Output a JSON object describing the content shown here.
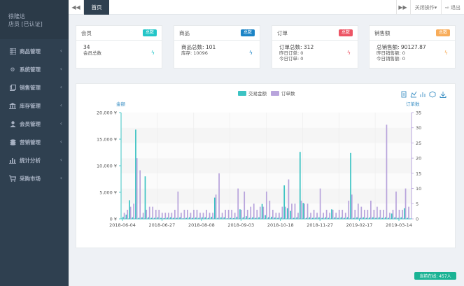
{
  "user": {
    "name": "徐隆达",
    "role": "店员 [已认证]"
  },
  "sidebar": {
    "items": [
      {
        "label": "商品管理",
        "icon": "grid-icon"
      },
      {
        "label": "系统管理",
        "icon": "gear-icon"
      },
      {
        "label": "销售管理",
        "icon": "copy-icon"
      },
      {
        "label": "库存管理",
        "icon": "bank-icon"
      },
      {
        "label": "会员管理",
        "icon": "user-icon"
      },
      {
        "label": "营销管理",
        "icon": "coins-icon"
      },
      {
        "label": "统计分析",
        "icon": "bar-chart-icon"
      },
      {
        "label": "采购市场",
        "icon": "cart-icon"
      }
    ]
  },
  "topbar": {
    "tab": "首页",
    "close_ops": "关闭操作",
    "exit": "退出"
  },
  "cards": [
    {
      "title": "会员",
      "badge": "总数",
      "badge_color": "#23c6c8",
      "bolt_color": "#23c6c8",
      "lines": [
        "34",
        "会员总数"
      ]
    },
    {
      "title": "商品",
      "badge": "总数",
      "badge_color": "#1c84c6",
      "bolt_color": "#1c84c6",
      "lines": [
        "商品总数: 101",
        "库存: 10096"
      ]
    },
    {
      "title": "订单",
      "badge": "总数",
      "badge_color": "#ed5565",
      "bolt_color": "#ed5565",
      "lines": [
        "订单总数: 312",
        "昨日订单: 0",
        "今日订单: 0"
      ]
    },
    {
      "title": "销售额",
      "badge": "总数",
      "badge_color": "#f8ac59",
      "bolt_color": "#f8ac59",
      "lines": [
        "总销售额: 90127.87",
        "昨日销售额: 0",
        "今日销售额: 0"
      ]
    }
  ],
  "online": "当前在线: 457人",
  "chart_data": {
    "type": "bar",
    "ylabel_left": "金额",
    "ylabel_right": "订单数",
    "y_left_ticks": [
      "0 ¥",
      "5,000 ¥",
      "10,000 ¥",
      "15,000 ¥",
      "20,000 ¥"
    ],
    "y_left_max": 20000,
    "y_right_ticks": [
      "0",
      "5",
      "10",
      "15",
      "20",
      "25",
      "30",
      "35"
    ],
    "y_right_max": 35,
    "x_labels": [
      "2018-06-04",
      "2018-06-27",
      "2018-08-08",
      "2018-09-03",
      "2018-10-18",
      "2018-11-27",
      "2019-02-17",
      "2019-03-14"
    ],
    "legend": [
      "交易金额",
      "订单数"
    ],
    "colors": {
      "amount": "#3cc3c3",
      "orders": "#b8a4dc"
    },
    "series": [
      {
        "name": "交易金额",
        "values": [
          400,
          800,
          3500,
          300,
          16800,
          200,
          300,
          8000,
          300,
          200,
          200,
          300,
          200,
          150,
          250,
          300,
          200,
          200,
          300,
          100,
          200,
          300,
          200,
          250,
          200,
          300,
          300,
          200,
          400,
          4000,
          200,
          300,
          300,
          100,
          200,
          150,
          400,
          1800,
          300,
          500,
          200,
          300,
          200,
          300,
          2800,
          700,
          300,
          400,
          250,
          200,
          300,
          6300,
          2000,
          1500,
          200,
          300,
          12600,
          3000,
          200,
          300,
          200,
          250,
          300,
          200,
          300,
          200,
          1800,
          300,
          200,
          300,
          200,
          300,
          12400,
          200,
          300,
          200,
          300,
          200,
          250,
          300,
          200,
          300,
          200,
          300,
          200,
          1000,
          300,
          200,
          300,
          2000,
          200
        ]
      },
      {
        "name": "订单数",
        "values": [
          2,
          3,
          4,
          5,
          20,
          16,
          2,
          3,
          4,
          4,
          3,
          3,
          2,
          2,
          2,
          2,
          3,
          9,
          2,
          3,
          3,
          2,
          3,
          3,
          2,
          2,
          3,
          2,
          2,
          8,
          15,
          2,
          3,
          3,
          3,
          2,
          10,
          3,
          9,
          3,
          4,
          5,
          3,
          4,
          4,
          9,
          6,
          3,
          2,
          2,
          4,
          4,
          13,
          5,
          5,
          2,
          6,
          5,
          5,
          2,
          3,
          2,
          10,
          2,
          3,
          2,
          3,
          2,
          3,
          3,
          2,
          6,
          8,
          3,
          5,
          4,
          3,
          3,
          6,
          3,
          4,
          3,
          3,
          31,
          2,
          3,
          9,
          3,
          3,
          10,
          4
        ]
      }
    ]
  }
}
